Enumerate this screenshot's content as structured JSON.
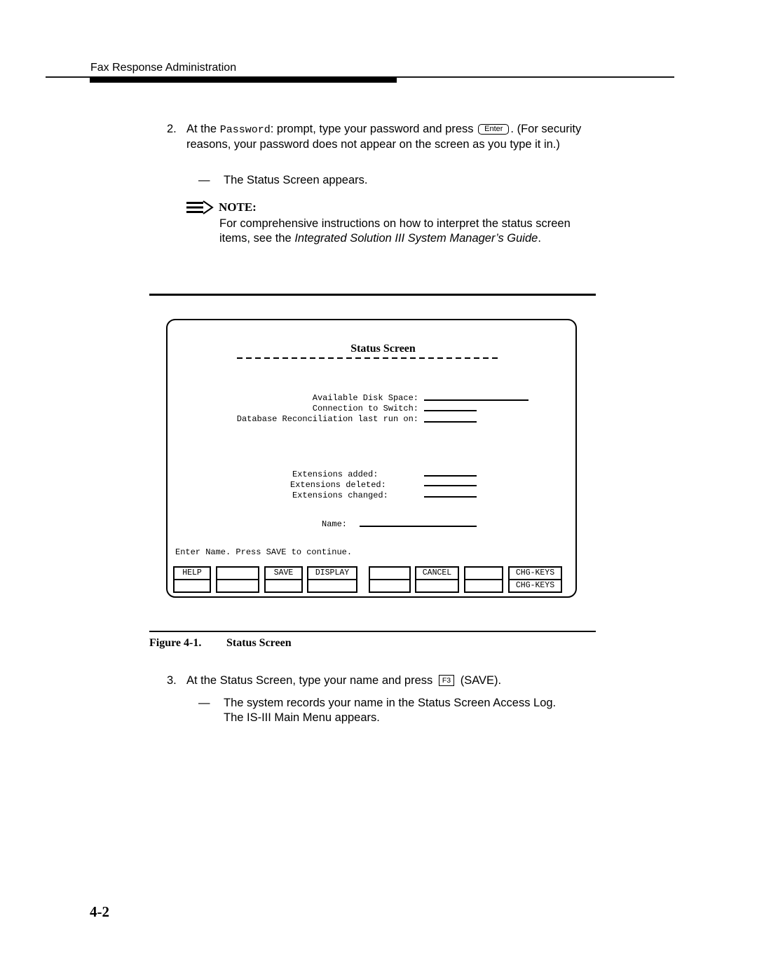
{
  "header": {
    "running_title": "Fax Response Administration"
  },
  "step2": {
    "number": "2.",
    "text_before": "At the ",
    "prompt_code": "Password",
    "text_mid": ": prompt, type your password and press ",
    "key": "Enter",
    "text_after": ".  (For security reasons, your password does not appear on the screen as you type it in.)",
    "result_dash": "—",
    "result": "The Status Screen appears."
  },
  "note": {
    "icon": "note-arrow-icon",
    "label": "NOTE:",
    "text_before": "For comprehensive instructions on how to interpret the status screen items, see the ",
    "reference": "Integrated Solution III System Manager’s Guide",
    "text_after": "."
  },
  "figure": {
    "screen": {
      "title": "Status Screen",
      "fields_top": [
        {
          "label": "Available Disk Space:",
          "value": ""
        },
        {
          "label": "Connection to Switch:",
          "value": ""
        },
        {
          "label": "Database Reconciliation last run on:",
          "value": ""
        }
      ],
      "fields_ext": [
        {
          "label": "Extensions added:",
          "value": ""
        },
        {
          "label": "Extensions deleted:",
          "value": ""
        },
        {
          "label": "Extensions changed:",
          "value": ""
        }
      ],
      "name_field": {
        "label": "Name:",
        "value": ""
      },
      "message": "Enter Name. Press SAVE to continue.",
      "function_keys": [
        {
          "top": "HELP",
          "bottom": ""
        },
        {
          "top": "",
          "bottom": ""
        },
        {
          "top": "SAVE",
          "bottom": ""
        },
        {
          "top": "DISPLAY",
          "bottom": ""
        },
        {
          "top": "",
          "bottom": ""
        },
        {
          "top": "CANCEL",
          "bottom": ""
        },
        {
          "top": "",
          "bottom": ""
        },
        {
          "top": "CHG-KEYS",
          "bottom": "CHG-KEYS"
        }
      ]
    },
    "caption_number": "Figure 4-1.",
    "caption_title": "Status Screen"
  },
  "step3": {
    "number": "3.",
    "text_before": "At the Status Screen, type your name and press ",
    "key": "F3",
    "text_after": " (SAVE).",
    "result_dash": "—",
    "result_line1": "The system records your name in the Status Screen Access Log.",
    "result_line2": "The IS-III Main Menu appears."
  },
  "footer": {
    "page_number": "4-2"
  }
}
